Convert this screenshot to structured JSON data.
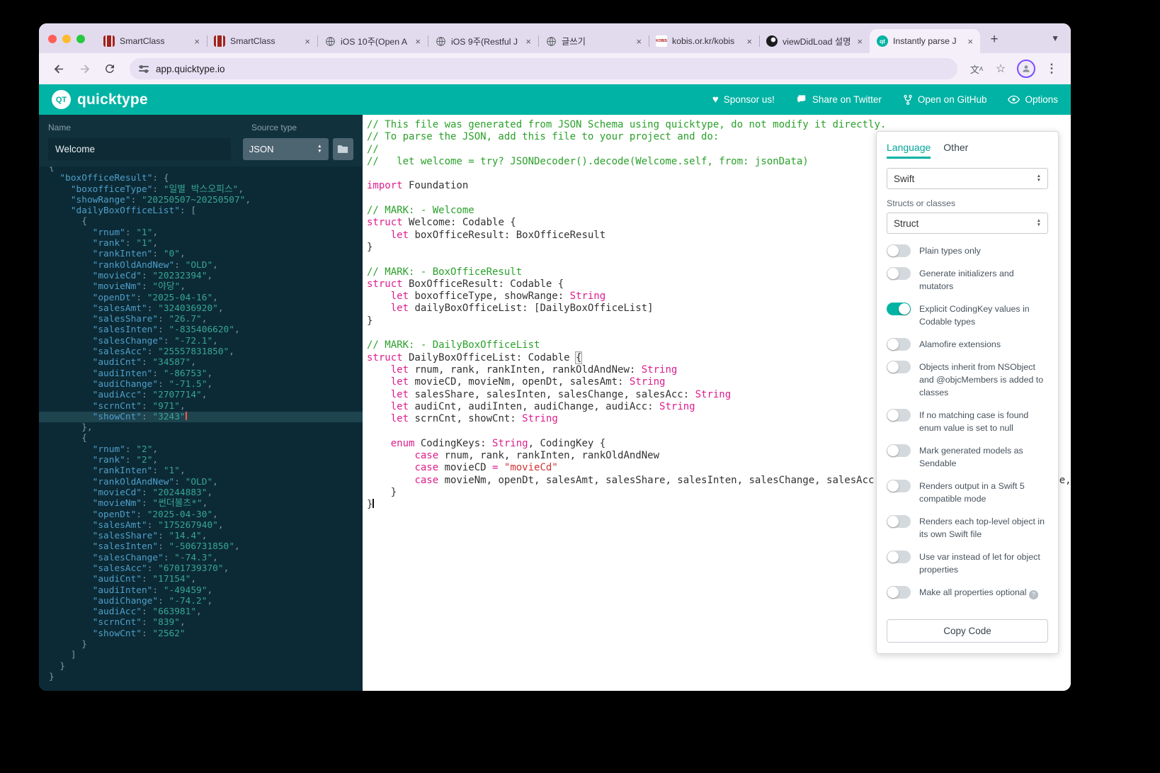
{
  "browser": {
    "url": "app.quicktype.io",
    "tabs": [
      {
        "title": "SmartClass",
        "icon": "edu"
      },
      {
        "title": "SmartClass",
        "icon": "edu"
      },
      {
        "title": "iOS 10주(Open A",
        "icon": "globe"
      },
      {
        "title": "iOS 9주(Restful J",
        "icon": "globe"
      },
      {
        "title": "글쓰기",
        "icon": "globe"
      },
      {
        "title": "kobis.or.kr/kobis",
        "icon": "kobis"
      },
      {
        "title": "viewDidLoad 설명",
        "icon": "swirl"
      },
      {
        "title": "Instantly parse J",
        "icon": "qt",
        "active": true
      }
    ]
  },
  "app": {
    "brand": "quicktype",
    "logo_text": "QT",
    "header_links": [
      {
        "label": "Sponsor us!",
        "icon": "heart"
      },
      {
        "label": "Share on Twitter",
        "icon": "chat"
      },
      {
        "label": "Open on GitHub",
        "icon": "fork"
      },
      {
        "label": "Options",
        "icon": "eye"
      }
    ]
  },
  "sidebar": {
    "name_label": "Name",
    "name_value": "Welcome",
    "source_type_label": "Source type",
    "source_type_value": "JSON",
    "active_line_contains": "\"showCnt\": \"3243\"",
    "json_input": {
      "boxOfficeResult": {
        "boxofficeType": "일별 박스오피스",
        "showRange": "20250507~20250507",
        "dailyBoxOfficeList": [
          {
            "rnum": "1",
            "rank": "1",
            "rankInten": "0",
            "rankOldAndNew": "OLD",
            "movieCd": "20232394",
            "movieNm": "야당",
            "openDt": "2025-04-16",
            "salesAmt": "324036920",
            "salesShare": "26.7",
            "salesInten": "-835406620",
            "salesChange": "-72.1",
            "salesAcc": "25557831850",
            "audiCnt": "34587",
            "audiInten": "-86753",
            "audiChange": "-71.5",
            "audiAcc": "2707714",
            "scrnCnt": "971",
            "showCnt": "3243"
          },
          {
            "rnum": "2",
            "rank": "2",
            "rankInten": "1",
            "rankOldAndNew": "OLD",
            "movieCd": "20244883",
            "movieNm": "썬더볼츠*",
            "openDt": "2025-04-30",
            "salesAmt": "175267940",
            "salesShare": "14.4",
            "salesInten": "-506731850",
            "salesChange": "-74.3",
            "salesAcc": "6701739370",
            "audiCnt": "17154",
            "audiInten": "-49459",
            "audiChange": "-74.2",
            "audiAcc": "663981",
            "scrnCnt": "839",
            "showCnt": "2562"
          }
        ]
      }
    }
  },
  "code": {
    "language": "swift",
    "bracket_highlight_line": 19,
    "caret_line": 31,
    "lines": [
      "// This file was generated from JSON Schema using quicktype, do not modify it directly.",
      "// To parse the JSON, add this file to your project and do:",
      "//",
      "//   let welcome = try? JSONDecoder().decode(Welcome.self, from: jsonData)",
      "",
      "import Foundation",
      "",
      "// MARK: - Welcome",
      "struct Welcome: Codable {",
      "    let boxOfficeResult: BoxOfficeResult",
      "}",
      "",
      "// MARK: - BoxOfficeResult",
      "struct BoxOfficeResult: Codable {",
      "    let boxofficeType, showRange: String",
      "    let dailyBoxOfficeList: [DailyBoxOfficeList]",
      "}",
      "",
      "// MARK: - DailyBoxOfficeList",
      "struct DailyBoxOfficeList: Codable {",
      "    let rnum, rank, rankInten, rankOldAndNew: String",
      "    let movieCD, movieNm, openDt, salesAmt: String",
      "    let salesShare, salesInten, salesChange, salesAcc: String",
      "    let audiCnt, audiInten, audiChange, audiAcc: String",
      "    let scrnCnt, showCnt: String",
      "",
      "    enum CodingKeys: String, CodingKey {",
      "        case rnum, rank, rankInten, rankOldAndNew",
      "        case movieCD = \"movieCd\"",
      "        case movieNm, openDt, salesAmt, salesShare, salesInten, salesChange, salesAcc, audiCnt, audiInten, audiChange, audiAcc",
      "    }",
      "}"
    ]
  },
  "panel": {
    "tabs": [
      "Language",
      "Other"
    ],
    "active_tab": "Language",
    "language_value": "Swift",
    "structs_label": "Structs or classes",
    "structs_value": "Struct",
    "copy_button": "Copy Code",
    "toggles": [
      {
        "label": "Plain types only",
        "on": false
      },
      {
        "label": "Generate initializers and mutators",
        "on": false
      },
      {
        "label": "Explicit CodingKey values in Codable types",
        "on": true
      },
      {
        "label": "Alamofire extensions",
        "on": false
      },
      {
        "label": "Objects inherit from NSObject and @objcMembers is added to classes",
        "on": false
      },
      {
        "label": "If no matching case is found enum value is set to null",
        "on": false
      },
      {
        "label": "Mark generated models as Sendable",
        "on": false
      },
      {
        "label": "Renders output in a Swift 5 compatible mode",
        "on": false
      },
      {
        "label": "Renders each top-level object in its own Swift file",
        "on": false
      },
      {
        "label": "Use var instead of let for object properties",
        "on": false
      },
      {
        "label": "Make all properties optional",
        "on": false,
        "help": true
      }
    ]
  },
  "colors": {
    "accent": "#00b3a4",
    "keyword": "#de1c8d",
    "comment": "#2aa12a",
    "json_key": "#4f9fca",
    "json_value": "#37a696"
  }
}
